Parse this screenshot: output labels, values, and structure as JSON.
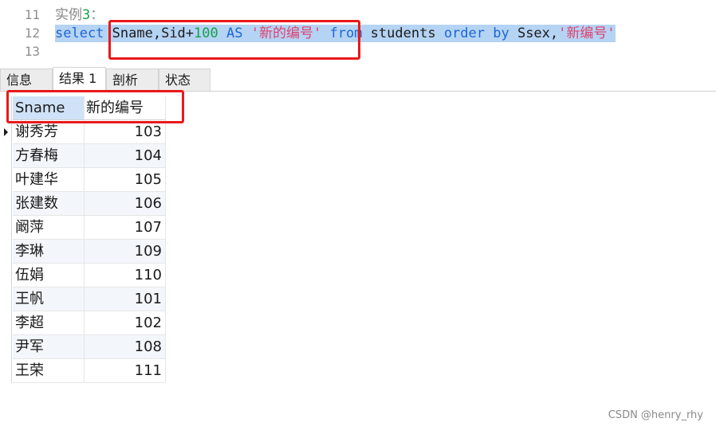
{
  "editor": {
    "line_11": {
      "number": "11",
      "comment_text": "实例",
      "comment_num": "3",
      "comment_colon": "："
    },
    "line_12": {
      "number": "12",
      "kw_select": "select",
      "id_cols": "Sname,Sid+",
      "num_100": "100",
      "kw_as": "AS",
      "str_alias": "'新的编号'",
      "kw_from": "from",
      "id_table": "students",
      "kw_order_by": "order by",
      "id_ssex": "Ssex,",
      "str_order": "'新编号'"
    },
    "line_13": {
      "number": "13"
    }
  },
  "tabs": [
    {
      "label": "信息",
      "active": false
    },
    {
      "label": "结果 1",
      "active": true
    },
    {
      "label": "剖析",
      "active": false
    },
    {
      "label": "状态",
      "active": false
    }
  ],
  "result_grid": {
    "columns": [
      "Sname",
      "新的编号"
    ],
    "rows": [
      [
        "谢秀芳",
        "103"
      ],
      [
        "方春梅",
        "104"
      ],
      [
        "叶建华",
        "105"
      ],
      [
        "张建数",
        "106"
      ],
      [
        "阚萍",
        "107"
      ],
      [
        "李琳",
        "109"
      ],
      [
        "伍娟",
        "110"
      ],
      [
        "王帆",
        "101"
      ],
      [
        "李超",
        "102"
      ],
      [
        "尹军",
        "108"
      ],
      [
        "王荣",
        "111"
      ]
    ]
  },
  "watermark": "CSDN @henry_rhy",
  "colors": {
    "annotation_red": "#e8191b",
    "selection": "#b5d3f3",
    "keyword": "#1d66d6",
    "string": "#e0406f",
    "number": "#16a04a"
  }
}
